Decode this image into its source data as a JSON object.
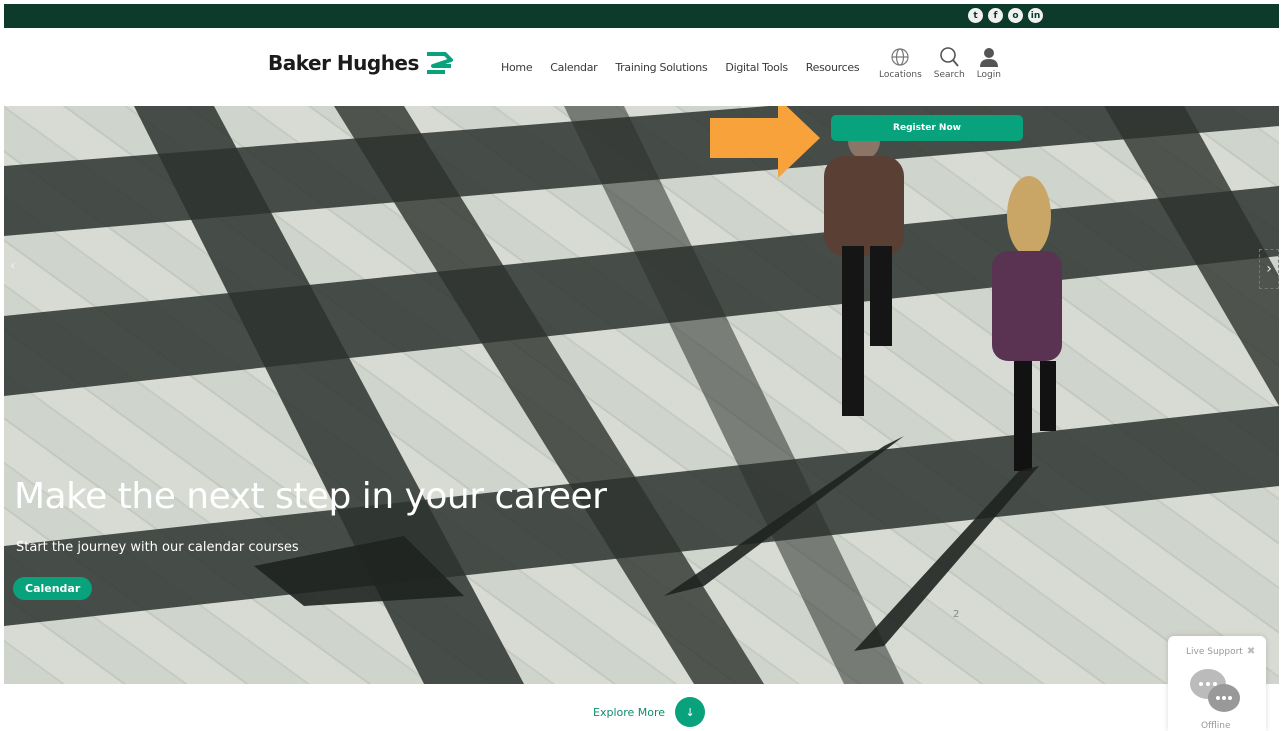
{
  "social": {
    "icons": [
      "twitter-icon",
      "facebook-icon",
      "instagram-icon",
      "linkedin-icon"
    ],
    "glyphs": [
      "t",
      "f",
      "o",
      "in"
    ]
  },
  "header": {
    "logo_text": "Baker Hughes",
    "nav": [
      "Home",
      "Calendar",
      "Training Solutions",
      "Digital Tools",
      "Resources"
    ],
    "tools": {
      "locations": "Locations",
      "search": "Search",
      "login": "Login"
    }
  },
  "hero": {
    "register_label": "Register Now",
    "title": "Make the next step in your career",
    "subtitle": "Start the journey with our calendar courses",
    "cta_label": "Calendar",
    "slide_number": "2",
    "prev": "‹",
    "next": "›"
  },
  "explore": {
    "label": "Explore More",
    "arrow": "↓"
  },
  "live_support": {
    "title": "Live Support",
    "close": "✖",
    "status": "Offline"
  },
  "colors": {
    "brand_green": "#08a37c",
    "dark_green": "#0c3b2b",
    "arrow_orange": "#f7a23b"
  }
}
